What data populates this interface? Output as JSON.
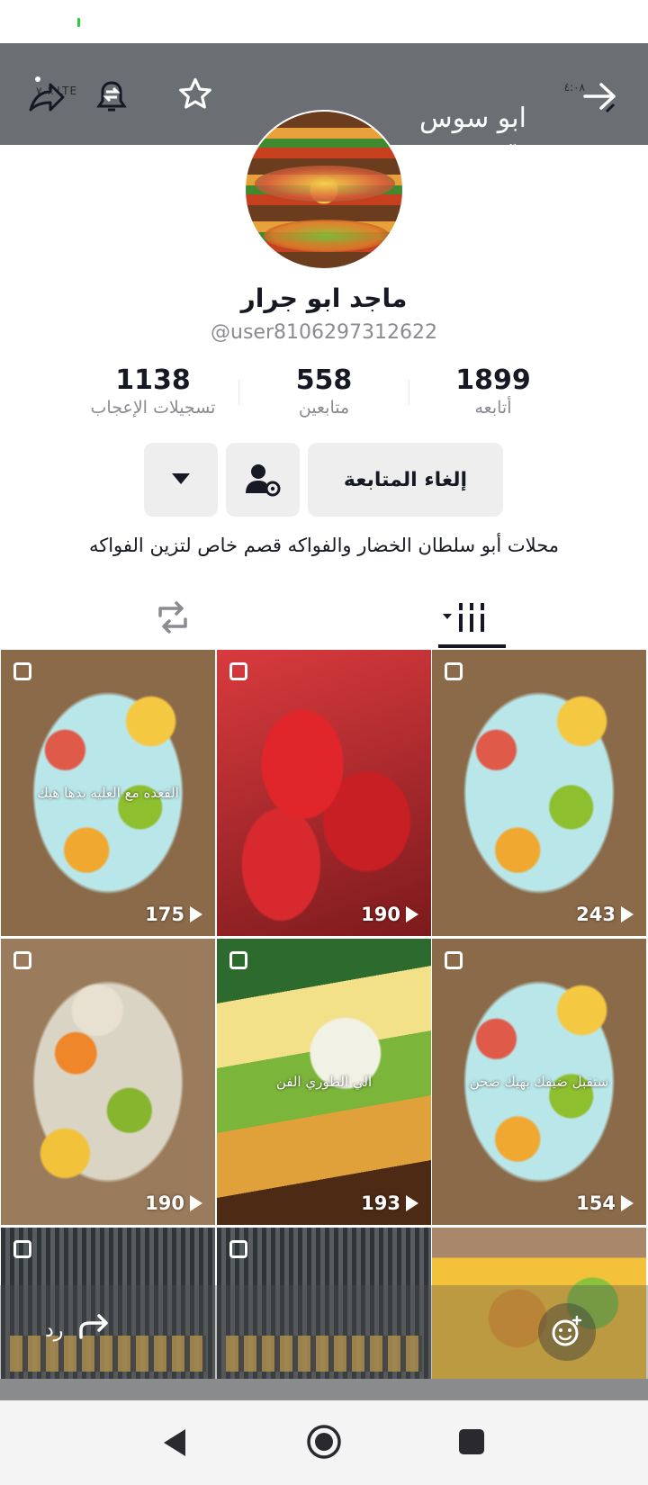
{
  "header": {
    "title": "ابو سوس",
    "subtitle": "الآن",
    "status_left": "۷۰٪ LTE",
    "status_right": "٤:٠٨",
    "icons": [
      "share-icon",
      "notification-bell-icon",
      "star-icon",
      "back-arrow-icon"
    ]
  },
  "profile": {
    "name": "ماجد ابو جرار",
    "handle": "@user8106297312622",
    "stats": [
      {
        "num": "1899",
        "label": "أتابعه"
      },
      {
        "num": "558",
        "label": "متابعين"
      },
      {
        "num": "1138",
        "label": "تسجيلات الإعجاب"
      }
    ],
    "buttons": {
      "unfollow": "إلغاء المتابعة"
    },
    "bio": "محلات أبو سلطان الخضار والفواكه قصم خاص لتزين الفواكه"
  },
  "grid": [
    {
      "views": "243",
      "caption": ""
    },
    {
      "views": "190",
      "caption": ""
    },
    {
      "views": "175",
      "caption": "القعده مع العليه بدها هيك"
    },
    {
      "views": "154",
      "caption": "ستقبل ضيفك بهيك صحن"
    },
    {
      "views": "193",
      "caption": "الي الطوري الفن"
    },
    {
      "views": "190",
      "caption": ""
    }
  ],
  "reply": {
    "label": "رد"
  },
  "colors": {
    "header_bg": "#6b6e72",
    "button_bg": "#eeeeef",
    "text_primary": "#161823",
    "text_secondary": "#8a8b91"
  }
}
